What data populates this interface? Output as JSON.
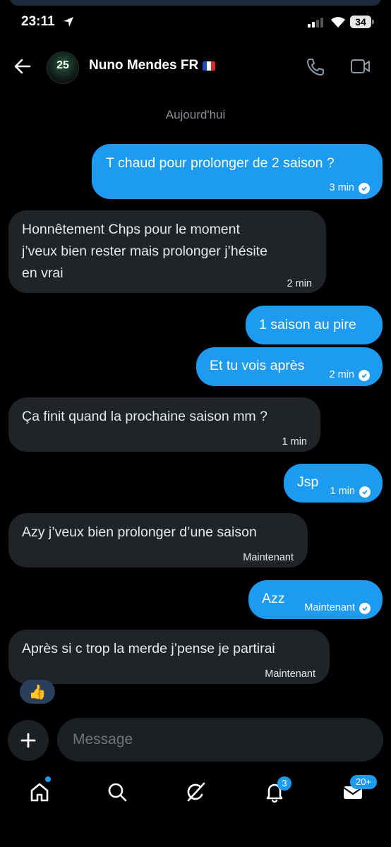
{
  "status_bar": {
    "time": "23:11",
    "battery": "34"
  },
  "header": {
    "contact_name": "Nuno Mendes FR",
    "avatar_text": "25"
  },
  "chat": {
    "day_label": "Aujourd'hui",
    "messages": [
      {
        "dir": "out",
        "lines": [
          "T chaud pour prolonger de 2 saison ?"
        ],
        "time": "3 min"
      },
      {
        "dir": "in",
        "lines": [
          "Honnêtement Chps pour le moment",
          "j’veux bien rester mais prolonger j’hésite",
          "en vrai"
        ],
        "time": "2 min"
      },
      {
        "dir": "out",
        "lines": [
          "1 saison au pire"
        ],
        "time": ""
      },
      {
        "dir": "out",
        "lines": [
          "Et tu vois après"
        ],
        "time": "2 min"
      },
      {
        "dir": "in",
        "lines": [
          "Ça finit quand la prochaine saison mm ?"
        ],
        "time": "1 min"
      },
      {
        "dir": "out",
        "lines": [
          "Jsp"
        ],
        "time": "1 min"
      },
      {
        "dir": "in",
        "lines": [
          "Azy j’veux bien prolonger d’une saison"
        ],
        "time": "Maintenant"
      },
      {
        "dir": "out",
        "lines": [
          "Azz"
        ],
        "time": "Maintenant"
      },
      {
        "dir": "in",
        "lines": [
          "Après si c trop la merde j’pense je partirai"
        ],
        "time": "Maintenant"
      }
    ],
    "reaction": "👍"
  },
  "composer": {
    "placeholder": "Message"
  },
  "tabbar": {
    "notifications_badge": "3",
    "messages_badge": "20+"
  },
  "colors": {
    "accent": "#1d9bf0",
    "incoming_bubble": "#202327",
    "background": "#000000"
  }
}
